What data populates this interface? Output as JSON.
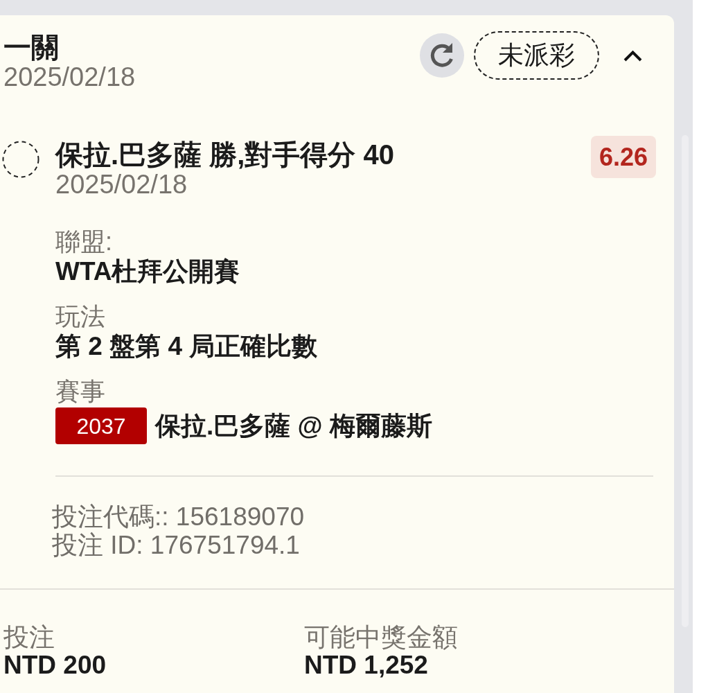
{
  "bet": {
    "title": "一關",
    "date": "2025/02/18",
    "status": "未派彩",
    "expanded": true
  },
  "selection": {
    "name": "保拉.巴多薩 勝,對手得分 40",
    "date": "2025/02/18",
    "odds": "6.26",
    "details": [
      {
        "kind": "text",
        "label": "聯盟:",
        "value": "WTA杜拜公開賽"
      },
      {
        "kind": "text",
        "label": "玩法",
        "value": "第 2 盤第 4 局正確比數"
      },
      {
        "kind": "event",
        "label": "賽事",
        "event_number": "2037",
        "value": "保拉.巴多薩 @ 梅爾藤斯"
      }
    ]
  },
  "codes": [
    "投注代碼:: 156189070",
    "投注 ID: 176751794.1"
  ],
  "summary": [
    {
      "label": "投注",
      "value": "NTD 200"
    },
    {
      "label": "可能中獎金額",
      "value": "NTD 1,252"
    }
  ]
}
